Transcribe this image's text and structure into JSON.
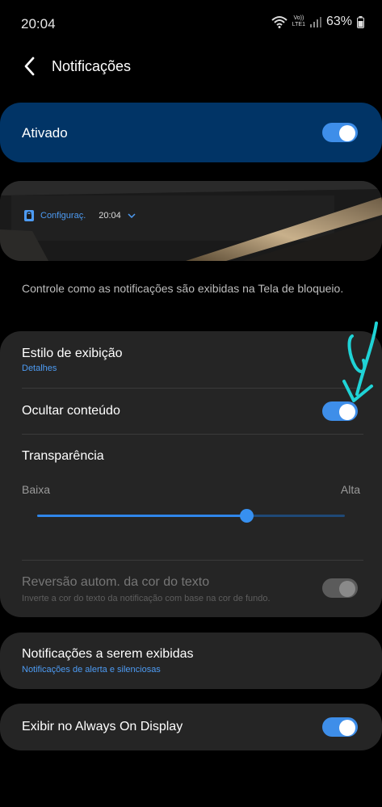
{
  "status": {
    "time": "20:04",
    "battery": "63%",
    "network_top": "Vo))",
    "network_bottom": "LTE1"
  },
  "header": {
    "title": "Notificações"
  },
  "master": {
    "label": "Ativado",
    "on": true
  },
  "preview": {
    "app_label": "Configuraç.",
    "time": "20:04"
  },
  "description": "Controle como as notificações são exibidas na Tela de bloqueio.",
  "settings": {
    "display_style": {
      "title": "Estilo de exibição",
      "value": "Detalhes"
    },
    "hide_content": {
      "title": "Ocultar conteúdo",
      "on": true
    },
    "transparency": {
      "title": "Transparência",
      "low": "Baixa",
      "high": "Alta",
      "level": 0.68
    },
    "auto_reverse": {
      "title": "Reversão autom. da cor do texto",
      "subtitle": "Inverte a cor do texto da notificação com base na cor de fundo.",
      "on": true,
      "enabled": false
    }
  },
  "notifications_to_show": {
    "title": "Notificações a serem exibidas",
    "value": "Notificações de alerta e silenciosas"
  },
  "always_on_display": {
    "title": "Exibir no Always On Display",
    "on": true
  },
  "colors": {
    "accent": "#3e8ee9",
    "master_bg": "#013466",
    "card_bg": "#252525",
    "annotation": "#1fd3d6"
  }
}
